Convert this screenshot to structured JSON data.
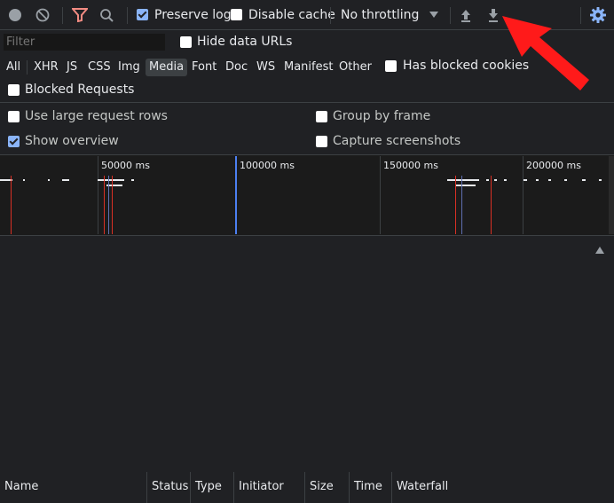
{
  "toolbar": {
    "preserve_log_label": "Preserve log",
    "preserve_log_checked": true,
    "disable_cache_label": "Disable cache",
    "disable_cache_checked": false,
    "throttling_value": "No throttling"
  },
  "filter_bar": {
    "filter_placeholder": "Filter",
    "hide_data_urls_label": "Hide data URLs",
    "hide_data_urls_checked": false
  },
  "type_filters": {
    "items": [
      "All",
      "XHR",
      "JS",
      "CSS",
      "Img",
      "Media",
      "Font",
      "Doc",
      "WS",
      "Manifest",
      "Other"
    ],
    "active": "Media",
    "has_blocked_cookies_label": "Has blocked cookies",
    "blocked_requests_label": "Blocked Requests"
  },
  "settings": {
    "use_large_rows_label": "Use large request rows",
    "use_large_rows_checked": false,
    "show_overview_label": "Show overview",
    "show_overview_checked": true,
    "group_by_frame_label": "Group by frame",
    "group_by_frame_checked": false,
    "capture_screenshots_label": "Capture screenshots",
    "capture_screenshots_checked": false
  },
  "overview": {
    "ticks": [
      "50000 ms",
      "100000 ms",
      "150000 ms",
      "200000 ms"
    ]
  },
  "table": {
    "columns": [
      "Name",
      "Status",
      "Type",
      "Initiator",
      "Size",
      "Time",
      "Waterfall"
    ]
  },
  "colors": {
    "record_stopped": "#9aa0a6",
    "filter_active": "#f28b82",
    "accent": "#8ab4f8",
    "arrow": "#ff1a1a"
  }
}
